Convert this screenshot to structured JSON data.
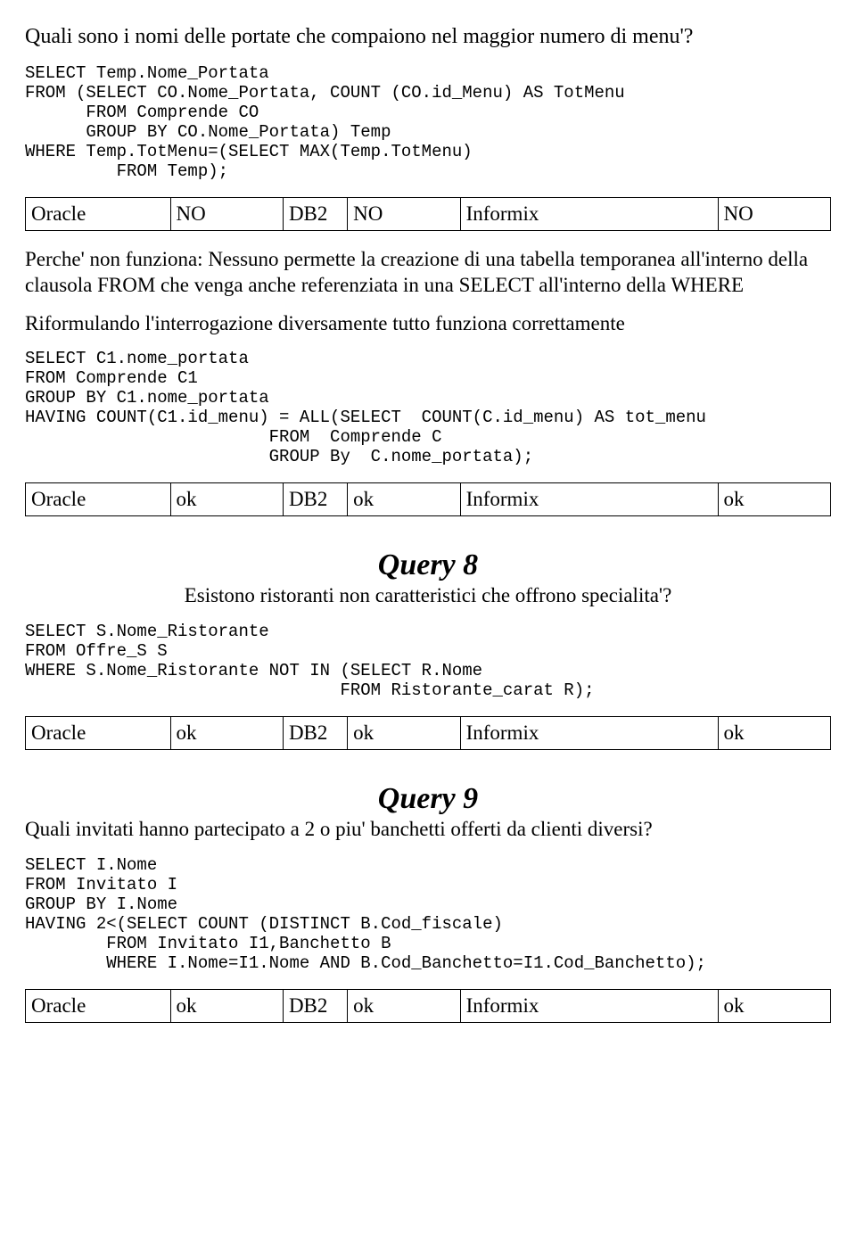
{
  "db_labels": {
    "oracle": "Oracle",
    "db2": "DB2",
    "informix": "Informix"
  },
  "top": {
    "question": "Quali sono i nomi delle portate che compaiono nel maggior numero di menu'?",
    "code1": "SELECT Temp.Nome_Portata\nFROM (SELECT CO.Nome_Portata, COUNT (CO.id_Menu) AS TotMenu\n      FROM Comprende CO\n      GROUP BY CO.Nome_Portata) Temp\nWHERE Temp.TotMenu=(SELECT MAX(Temp.TotMenu)\n         FROM Temp);",
    "results1": {
      "oracle": "NO",
      "db2": "NO",
      "informix": "NO"
    },
    "explain1": "Perche' non funziona: Nessuno permette la creazione di una tabella temporanea all'interno della clausola FROM che venga anche referenziata in una SELECT all'interno della WHERE",
    "explain2": "Riformulando l'interrogazione diversamente tutto funziona correttamente",
    "code2": "SELECT C1.nome_portata\nFROM Comprende C1\nGROUP BY C1.nome_portata\nHAVING COUNT(C1.id_menu) = ALL(SELECT  COUNT(C.id_menu) AS tot_menu\n                        FROM  Comprende C\n                        GROUP By  C.nome_portata);",
    "results2": {
      "oracle": "ok",
      "db2": "ok",
      "informix": "ok"
    }
  },
  "q8": {
    "title": "Query 8",
    "question": "Esistono ristoranti non caratteristici che offrono specialita'?",
    "code": "SELECT S.Nome_Ristorante\nFROM Offre_S S\nWHERE S.Nome_Ristorante NOT IN (SELECT R.Nome\n                               FROM Ristorante_carat R);",
    "results": {
      "oracle": "ok",
      "db2": "ok",
      "informix": "ok"
    }
  },
  "q9": {
    "title": "Query 9",
    "question": "Quali invitati hanno partecipato a 2 o piu' banchetti offerti da clienti diversi?",
    "code": "SELECT I.Nome\nFROM Invitato I\nGROUP BY I.Nome\nHAVING 2<(SELECT COUNT (DISTINCT B.Cod_fiscale)\n        FROM Invitato I1,Banchetto B\n        WHERE I.Nome=I1.Nome AND B.Cod_Banchetto=I1.Cod_Banchetto);",
    "results": {
      "oracle": "ok",
      "db2": "ok",
      "informix": "ok"
    }
  }
}
